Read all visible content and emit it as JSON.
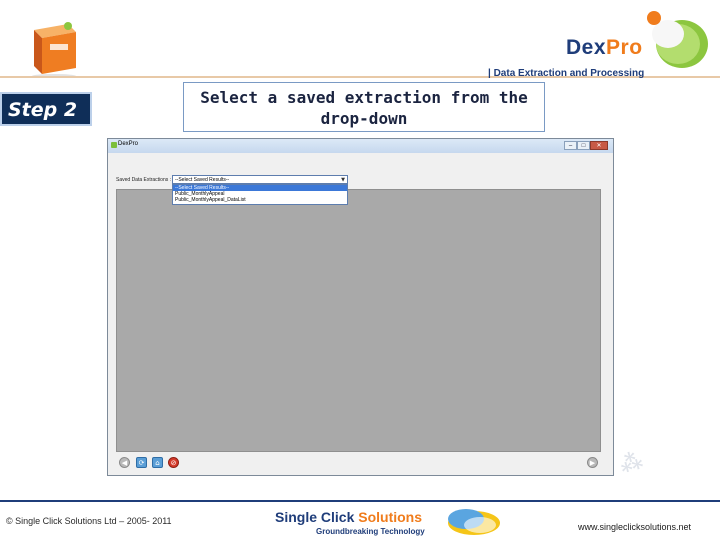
{
  "header": {
    "logo_dex": "Dex",
    "logo_pro": "Pro",
    "tagline": "| Data Extraction and Processing",
    "step_label": "Step 2",
    "instruction": "Select a saved extraction from the drop-down"
  },
  "app_window": {
    "title": "DexPro",
    "buttons": {
      "minimize": "–",
      "maximize": "□",
      "close": "✕"
    },
    "saved_extractions_label": "Saved Data Extractions :",
    "dropdown": {
      "selected_value": "--Select Saved Results--",
      "arrow": "▼",
      "options": [
        "--Select Saved Results--",
        "Public_MonthlyAppeal",
        "Public_MonthlyAppeal_DataList"
      ]
    },
    "nav_icons": [
      "back-icon",
      "refresh-icon",
      "home-icon",
      "stop-icon",
      "forward-icon"
    ]
  },
  "footer": {
    "copyright": "© Single Click Solutions Ltd – 2005- 2011",
    "company_single_click": "Single Click",
    "company_solutions": "Solutions",
    "slogan": "Groundbreaking Technology",
    "website": "www.singleclicksolutions.net"
  },
  "colors": {
    "navy": "#1f3d7a",
    "orange": "#f07c1c",
    "step_bg": "#0f2e58",
    "results_gray": "#a9a9a9"
  }
}
